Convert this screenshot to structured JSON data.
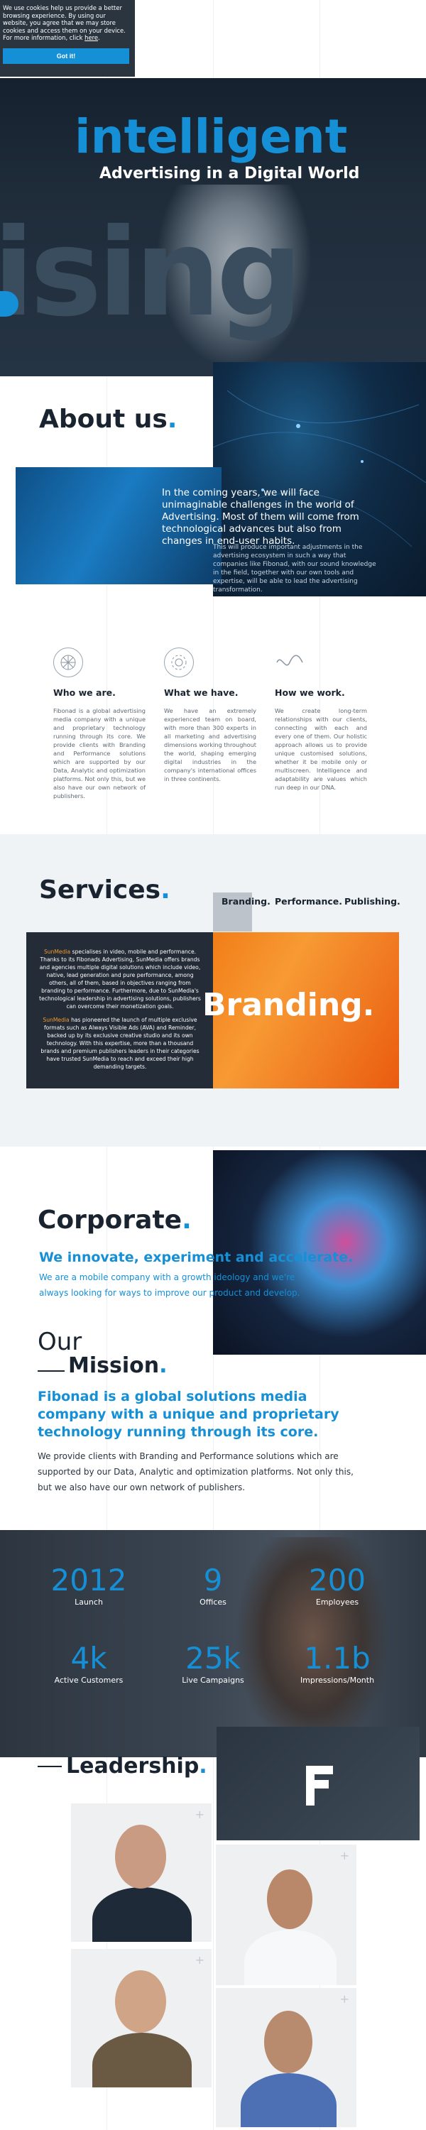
{
  "cookie": {
    "text": "We use cookies help us provide a better browsing experience. By using our website, you agree that we may store cookies and access them on your device.",
    "more_prefix": "For more information, click",
    "more_link": "here",
    "button": "Got it!"
  },
  "hero": {
    "background_word": "ising",
    "headline": "intelligent",
    "subheadline": "Advertising in a Digital World"
  },
  "about": {
    "title": "About us",
    "lead": "In the coming years, we will face unimaginable challenges in the world of Advertising. Most of them will come from technological advances but also from changes in end-user habits.",
    "body": "This will produce important adjustments in the advertising ecosystem in such a way that companies like Fibonad, with our sound knowledge in the field, together with our own tools and expertise, will be able to lead the advertising transformation.",
    "features": [
      {
        "icon": "globe-icon",
        "title": "Who we are.",
        "text": "Fibonad is a global advertising media company with a unique and proprietary technology running through its core. We provide clients with Branding and Performance solutions which are supported by our Data, Analytic and optimization platforms. Not only this, but we also have our own network of publishers."
      },
      {
        "icon": "gear-icon",
        "title": "What we have.",
        "text": "We have an extremely experienced team on board, with more than 300 experts in all marketing and advertising dimensions working throughout the world, shaping emerging digital industries in the company's international offices in three continents."
      },
      {
        "icon": "wave-icon",
        "title": "How we work.",
        "text": "We create long-term relationships with our clients, connecting with each and every one of them. Our holistic approach allows us to provide unique customised solutions, whether it be mobile only or multiscreen. Intelligence and adaptability are values which run deep in our DNA."
      }
    ]
  },
  "services": {
    "title": "Services",
    "tabs": [
      "Branding.",
      "Performance.",
      "Publishing."
    ],
    "p1_highlight": "SunMedia",
    "p1": " specialises in video, mobile and performance. Thanks to its Fibonads Advertising, SunMedia offers brands and agencies multiple digital solutions which include video, native, lead generation and pure performance, among others, all of them, based in objectives ranging from branding to performance. Furthermore, due to SunMedia's technological leadership in advertising solutions, publishers can overcome their monetization goals.",
    "p2_highlight": "SunMedia",
    "p2": " has pioneered the launch of multiple exclusive formats such as Always Visible Ads (AVA) and Reminder, backed up by its exclusive creative studio and its own technology. With this expertise, more than a thousand brands and premium publishers leaders in their categories have trusted SunMedia to reach and exceed their high demanding targets.",
    "feature_word": "Branding."
  },
  "corporate": {
    "title": "Corporate",
    "lead": "We innovate, experiment and accelerate.",
    "sub": "We are a mobile company with a growth ideology and we're always looking for ways to improve our product and develop."
  },
  "mission": {
    "our": "Our",
    "title": "Mission",
    "lead": "Fibonad is a global solutions media company with a unique and proprietary technology running through its core.",
    "body": "We provide clients with Branding and Performance solutions which are supported by our Data, Analytic and optimization platforms. Not only this, but we also have our own network of publishers."
  },
  "stats": [
    {
      "num": "2012",
      "label": "Launch"
    },
    {
      "num": "9",
      "label": "Offices"
    },
    {
      "num": "200",
      "label": "Employees"
    },
    {
      "num": "4k",
      "label": "Active Customers"
    },
    {
      "num": "25k",
      "label": "Live Campaigns"
    },
    {
      "num": "1.1b",
      "label": "Impressions/Month"
    }
  ],
  "leadership": {
    "title": "Leadership",
    "plus_icon": "+"
  },
  "colors": {
    "accent": "#1590d6",
    "dark": "#232c37",
    "orange": "#f27d17"
  }
}
